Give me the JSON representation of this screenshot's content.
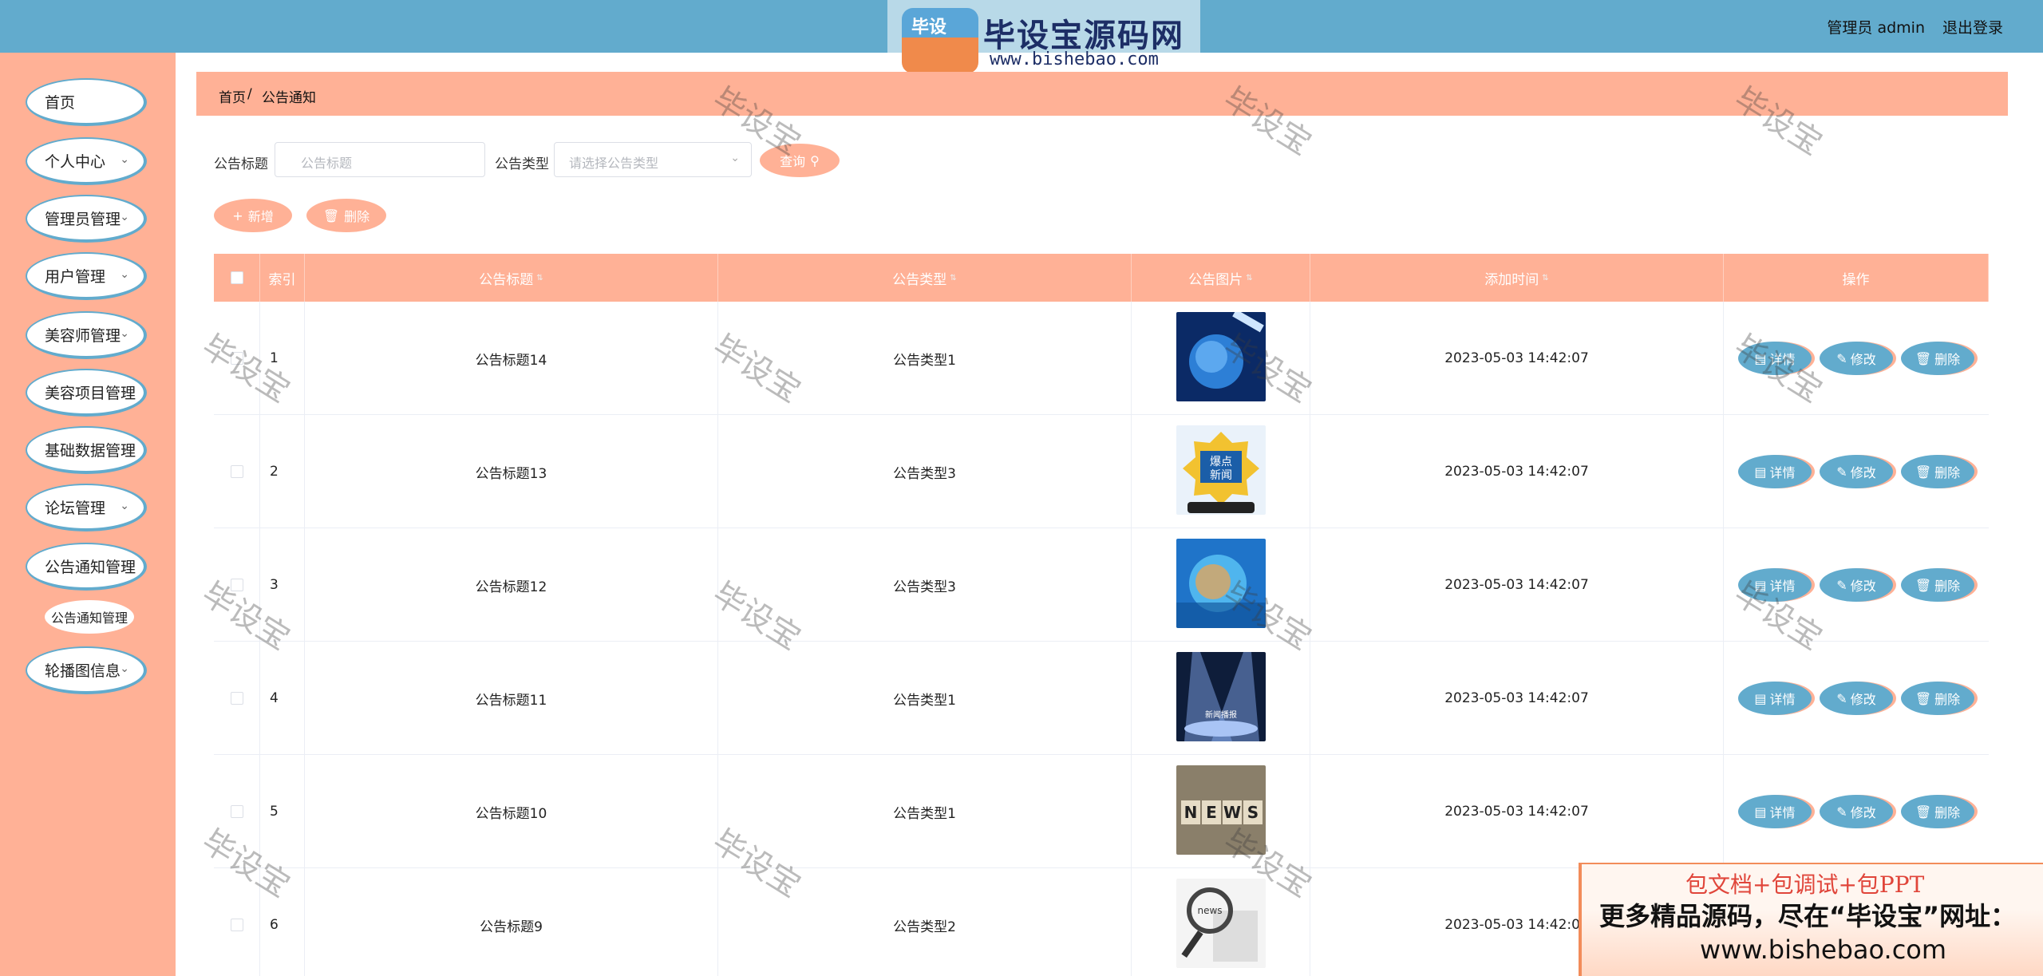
{
  "header": {
    "user_label": "管理员 admin",
    "logout_label": "退出登录",
    "logo": {
      "badge": "毕设",
      "name": "毕设宝源码网",
      "url": "www.bishebao.com"
    }
  },
  "sidebar": {
    "items": [
      {
        "label": "首页",
        "has_children": false
      },
      {
        "label": "个人中心",
        "has_children": true
      },
      {
        "label": "管理员管理",
        "has_children": true
      },
      {
        "label": "用户管理",
        "has_children": true
      },
      {
        "label": "美容师管理",
        "has_children": true
      },
      {
        "label": "美容项目管理",
        "has_children": true
      },
      {
        "label": "基础数据管理",
        "has_children": true
      },
      {
        "label": "论坛管理",
        "has_children": true
      },
      {
        "label": "公告通知管理",
        "has_children": true
      },
      {
        "label": "轮播图信息",
        "has_children": true
      }
    ],
    "active_submenu": "公告通知管理"
  },
  "breadcrumb": {
    "home": "首页",
    "separator": "/",
    "current": "公告通知"
  },
  "search": {
    "title_label": "公告标题",
    "title_placeholder": "公告标题",
    "type_label": "公告类型",
    "type_placeholder": "请选择公告类型",
    "query_button": "查询"
  },
  "actions": {
    "add_label": "新增",
    "delete_label": "删除"
  },
  "table": {
    "columns": [
      "索引",
      "公告标题",
      "公告类型",
      "公告图片",
      "添加时间",
      "操作"
    ],
    "row_actions": {
      "detail": "详情",
      "edit": "修改",
      "delete": "删除"
    },
    "rows": [
      {
        "index": "1",
        "title": "公告标题14",
        "type": "公告类型1",
        "image": "globe-tech",
        "time": "2023-05-03 14:42:07"
      },
      {
        "index": "2",
        "title": "公告标题13",
        "type": "公告类型3",
        "image": "hot-news-badge",
        "time": "2023-05-03 14:42:07"
      },
      {
        "index": "3",
        "title": "公告标题12",
        "type": "公告类型3",
        "image": "digital-earth",
        "time": "2023-05-03 14:42:07"
      },
      {
        "index": "4",
        "title": "公告标题11",
        "type": "公告类型1",
        "image": "spotlight-stage",
        "time": "2023-05-03 14:42:07"
      },
      {
        "index": "5",
        "title": "公告标题10",
        "type": "公告类型1",
        "image": "news-blocks",
        "time": "2023-05-03 14:42:07"
      },
      {
        "index": "6",
        "title": "公告标题9",
        "type": "公告类型2",
        "image": "magnifier-newspaper",
        "time": "2023-05-03 14:42:07"
      }
    ]
  },
  "watermark_text": "毕设宝",
  "ad": {
    "line1": "包文档+包调试+包PPT",
    "line2": "更多精品源码，尽在“毕设宝”网址：",
    "line3": "www.bishebao.com"
  },
  "colors": {
    "header": "#62abcd",
    "accent": "#ffb196",
    "primary_button": "#62abcd"
  }
}
